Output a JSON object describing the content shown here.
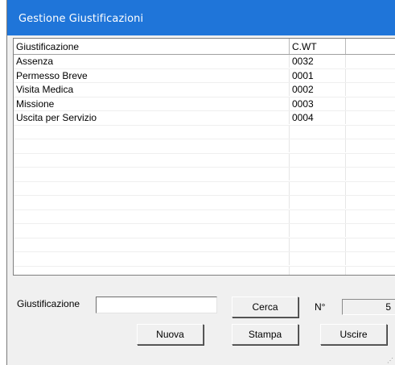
{
  "window": {
    "title": "Gestione Giustificazioni"
  },
  "grid": {
    "columns": [
      "Giustificazione",
      "C.WT",
      ""
    ],
    "rows": [
      [
        "Assenza",
        "0032",
        ""
      ],
      [
        "Permesso Breve",
        "0001",
        ""
      ],
      [
        "Visita Medica",
        "0002",
        ""
      ],
      [
        "Missione",
        "0003",
        ""
      ],
      [
        "Uscita per Servizio",
        "0004",
        ""
      ],
      [
        "",
        "",
        ""
      ],
      [
        "",
        "",
        ""
      ],
      [
        "",
        "",
        ""
      ],
      [
        "",
        "",
        ""
      ],
      [
        "",
        "",
        ""
      ],
      [
        "",
        "",
        ""
      ],
      [
        "",
        "",
        ""
      ],
      [
        "",
        "",
        ""
      ],
      [
        "",
        "",
        ""
      ],
      [
        "",
        "",
        ""
      ],
      [
        "",
        "",
        ""
      ]
    ]
  },
  "search": {
    "label": "Giustificazione",
    "value": "",
    "button_label": "Cerca"
  },
  "counter": {
    "label": "N°",
    "value": "5"
  },
  "buttons": {
    "new_label": "Nuova",
    "print_label": "Stampa",
    "exit_label": "Uscire"
  },
  "colors": {
    "titlebar": "#1f75d9",
    "window_bg": "#f0f0f0"
  }
}
